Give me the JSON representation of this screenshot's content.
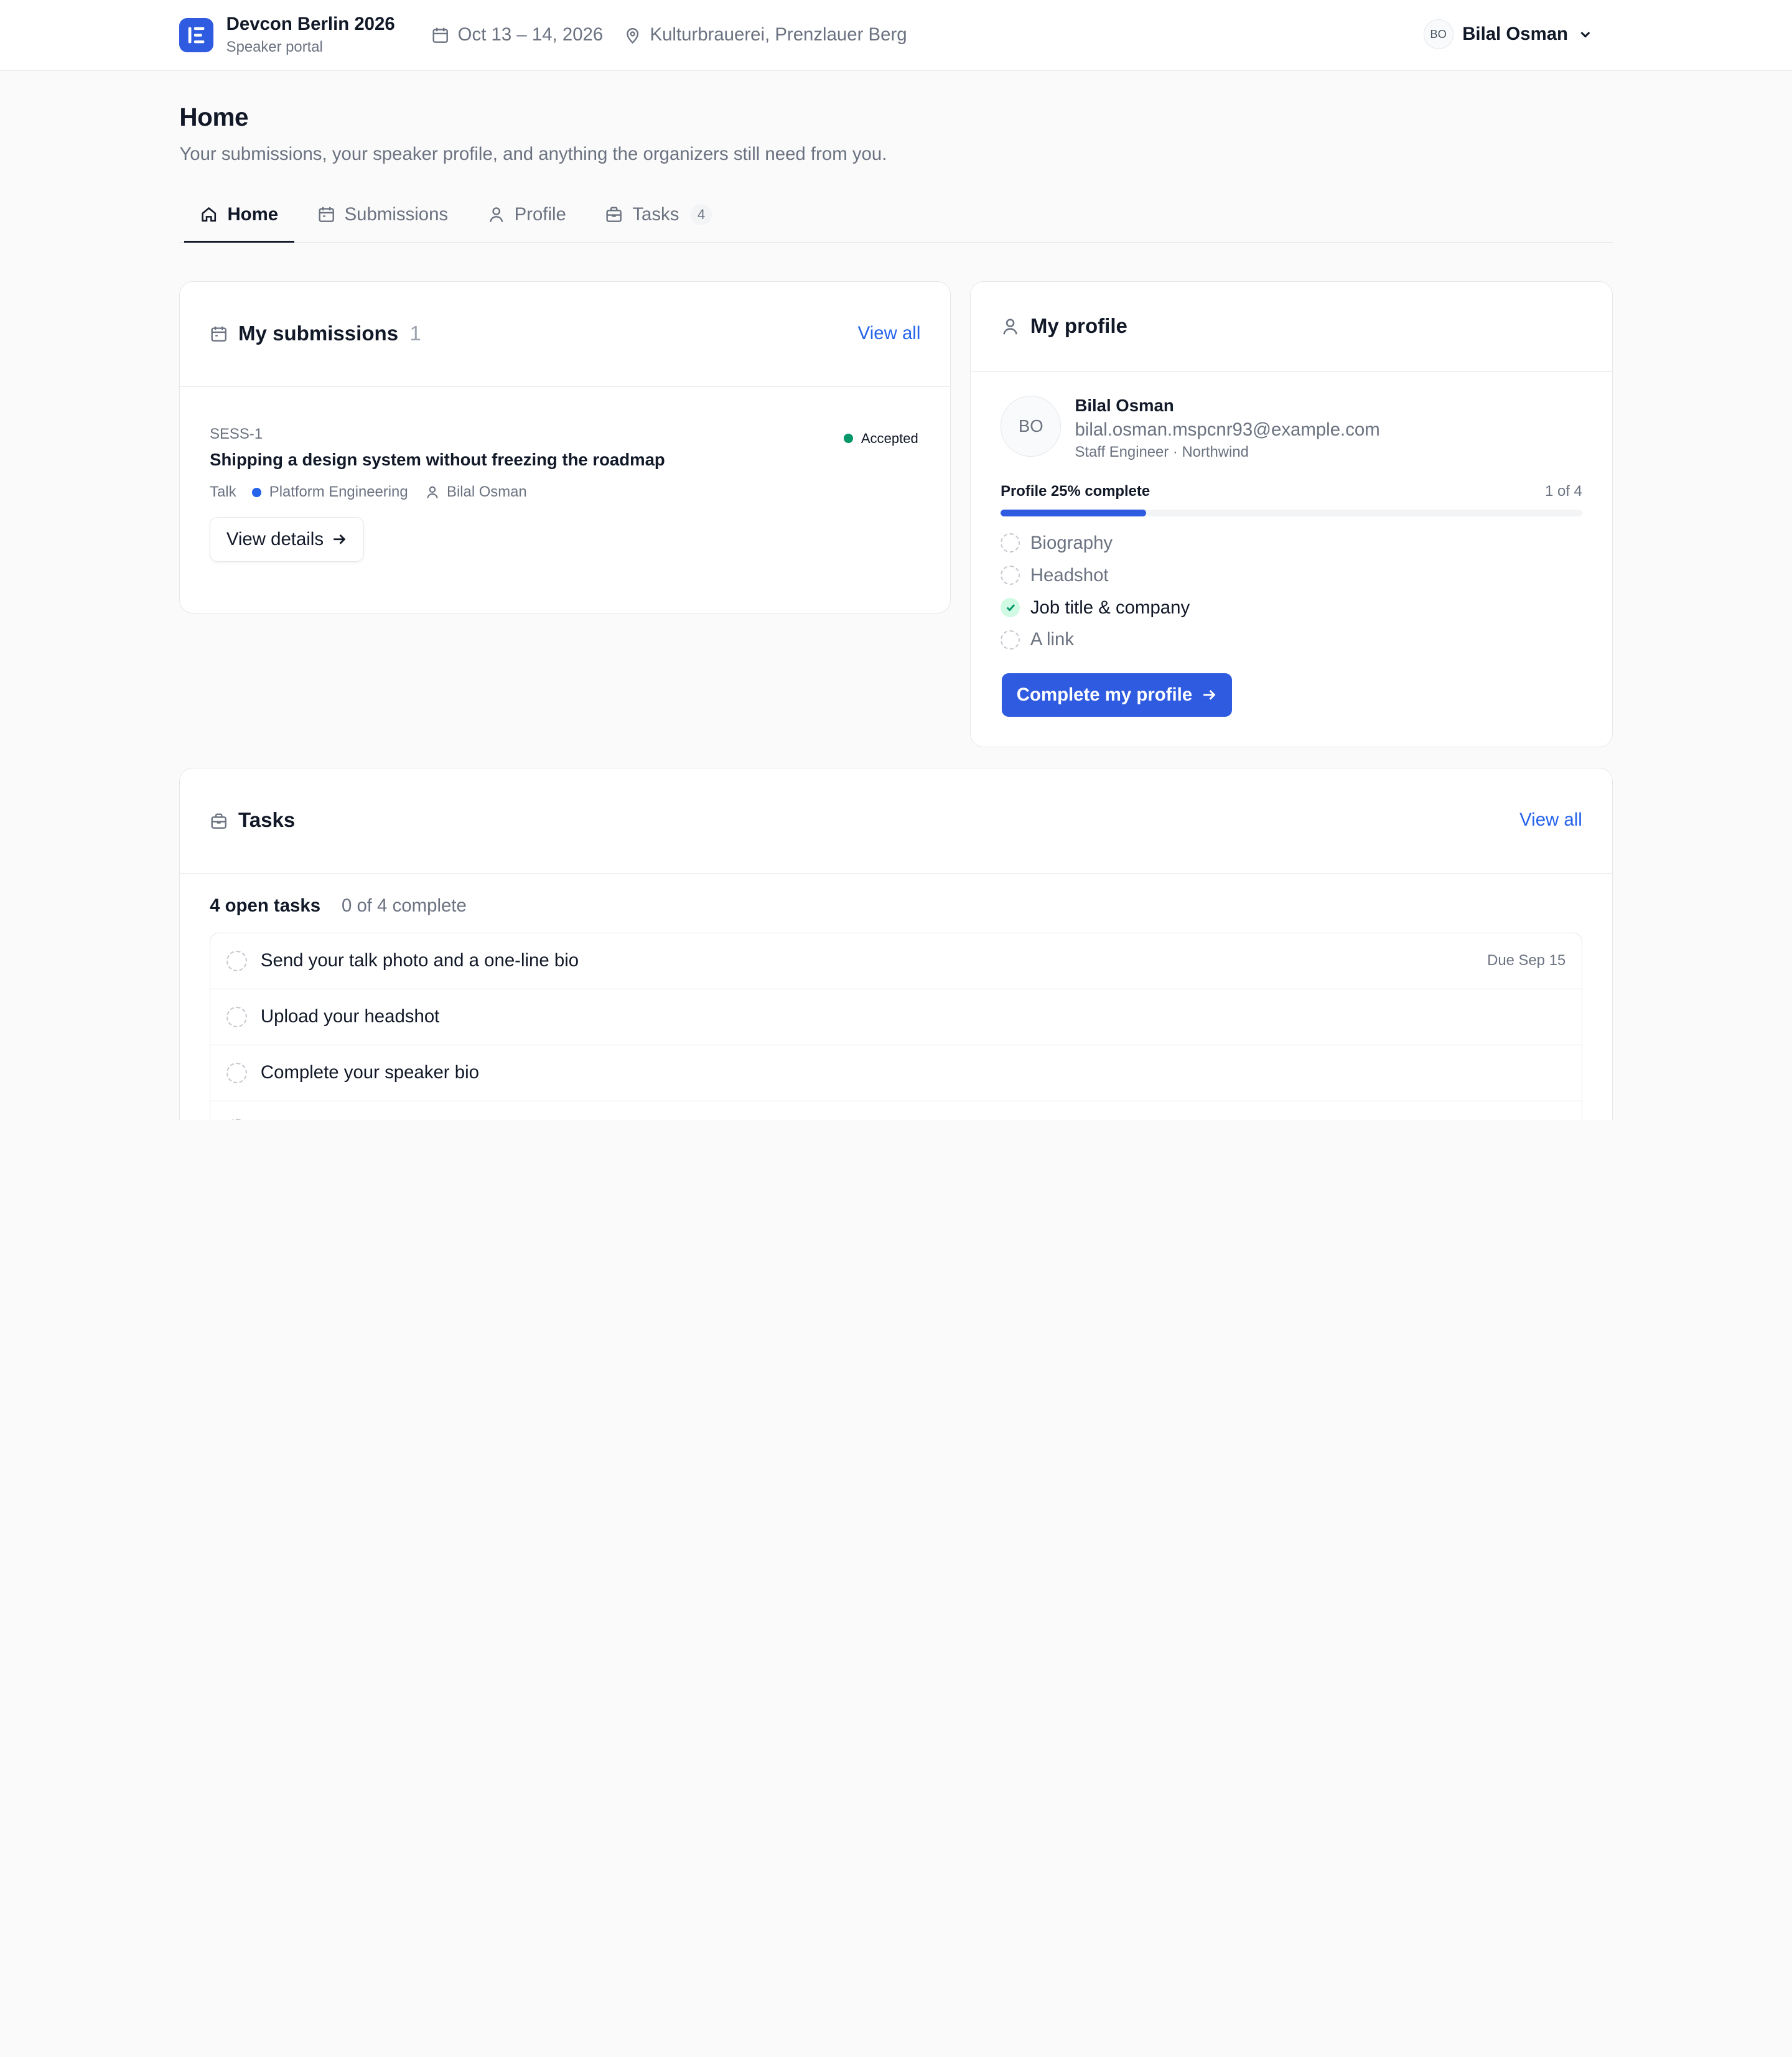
{
  "topbar": {
    "event_name": "Devcon Berlin 2026",
    "portal_label": "Speaker portal",
    "dates": "Oct 13 – 14, 2026",
    "venue": "Kulturbrauerei, Prenzlauer Berg",
    "user_initials": "BO",
    "user_name": "Bilal Osman"
  },
  "header": {
    "title": "Home",
    "subtitle": "Your submissions, your speaker profile, and anything the organizers still need from you."
  },
  "tabs": [
    {
      "label": "Home",
      "icon": "home-icon",
      "active": true
    },
    {
      "label": "Submissions",
      "icon": "calendar-icon"
    },
    {
      "label": "Profile",
      "icon": "user-icon"
    },
    {
      "label": "Tasks",
      "icon": "briefcase-icon",
      "count": "4"
    }
  ],
  "submissions": {
    "title": "My submissions",
    "count": "1",
    "view_all": "View all",
    "items": [
      {
        "id": "SESS-1",
        "status": "Accepted",
        "title": "Shipping a design system without freezing the roadmap",
        "format": "Talk",
        "track": "Platform Engineering",
        "speaker": "Bilal Osman",
        "details_label": "View details"
      }
    ]
  },
  "profile": {
    "title": "My profile",
    "initials": "BO",
    "name": "Bilal Osman",
    "email": "bilal.osman.mspcnr93@example.com",
    "role": "Staff Engineer · Northwind",
    "progress_label": "Profile 25% complete",
    "progress_count": "1 of 4",
    "progress_fraction": 0.25,
    "checklist": [
      {
        "label": "Biography",
        "done": false
      },
      {
        "label": "Headshot",
        "done": false
      },
      {
        "label": "Job title & company",
        "done": true
      },
      {
        "label": "A link",
        "done": false
      }
    ],
    "cta": "Complete my profile"
  },
  "tasks": {
    "title": "Tasks",
    "view_all": "View all",
    "open_count": "4 open tasks",
    "complete_count": "0 of 4 complete",
    "items": [
      {
        "label": "Send your talk photo and a one-line bio",
        "due": "Due Sep 15"
      },
      {
        "label": "Upload your headshot",
        "due": ""
      },
      {
        "label": "Complete your speaker bio",
        "due": ""
      }
    ]
  },
  "colors": {
    "accent": "#2f5be0",
    "link": "#2563eb",
    "success": "#059669"
  }
}
